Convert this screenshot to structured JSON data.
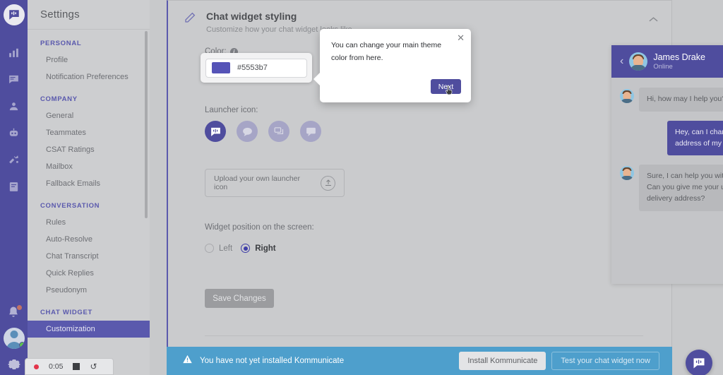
{
  "rail": {
    "logo_icon": "kommunicate-logo-icon",
    "icons": [
      "analytics-icon",
      "conversations-icon",
      "contacts-icon",
      "bot-icon",
      "integrations-icon",
      "knowledge-base-icon"
    ],
    "bell_icon": "notification-bell-icon",
    "avatar_icon": "user-avatar",
    "gear_icon": "gear-icon"
  },
  "sidebar": {
    "title": "Settings",
    "groups": [
      {
        "label": "PERSONAL",
        "items": [
          {
            "label": "Profile",
            "active": false
          },
          {
            "label": "Notification Preferences",
            "active": false
          }
        ]
      },
      {
        "label": "COMPANY",
        "items": [
          {
            "label": "General",
            "active": false
          },
          {
            "label": "Teammates",
            "active": false
          },
          {
            "label": "CSAT Ratings",
            "active": false
          },
          {
            "label": "Mailbox",
            "active": false
          },
          {
            "label": "Fallback Emails",
            "active": false
          }
        ]
      },
      {
        "label": "CONVERSATION",
        "items": [
          {
            "label": "Rules",
            "active": false
          },
          {
            "label": "Auto-Resolve",
            "active": false
          },
          {
            "label": "Chat Transcript",
            "active": false
          },
          {
            "label": "Quick Replies",
            "active": false
          },
          {
            "label": "Pseudonym",
            "active": false
          }
        ]
      },
      {
        "label": "CHAT WIDGET",
        "items": [
          {
            "label": "Customization",
            "active": true
          }
        ]
      }
    ]
  },
  "card": {
    "title": "Chat widget styling",
    "subtitle": "Customize how your chat widget looks like",
    "pencil_icon": "pencil-icon",
    "collapse_icon": "chevron-up-icon",
    "color": {
      "label": "Color:",
      "info_icon": "info-icon",
      "value": "#5553b7",
      "swatch_hex": "#5553b7"
    },
    "launcher": {
      "label": "Launcher icon:",
      "options": [
        "launcher-icon-kommunicate",
        "launcher-icon-speech-bubble",
        "launcher-icon-stacked-chat",
        "launcher-icon-square-chat"
      ],
      "selected_index": 0,
      "upload_text": "Upload your own launcher icon",
      "upload_icon": "upload-icon"
    },
    "position": {
      "label": "Widget position on the screen:",
      "options": [
        {
          "label": "Left",
          "selected": false
        },
        {
          "label": "Right",
          "selected": true
        }
      ]
    },
    "save_label": "Save Changes"
  },
  "chat_preview": {
    "back_icon": "chevron-left-icon",
    "agent_name": "James Drake",
    "agent_status": "Online",
    "messages": [
      {
        "from": "agent",
        "text": "Hi, how may I help you?"
      },
      {
        "from": "user",
        "text": "Hey, can I change the delivery address of my order?"
      },
      {
        "from": "agent",
        "text": "Sure, I can help you with this. Can you give me your updated delivery address?"
      }
    ],
    "fab_icon": "launcher-icon-kommunicate"
  },
  "tour": {
    "text": "You can change your main theme color from here.",
    "next_label": "Next",
    "close_icon": "close-icon",
    "cursor_icon": "pointer-cursor-icon"
  },
  "banner": {
    "warning_icon": "warning-icon",
    "text": "You have not yet installed Kommunicate",
    "install_label": "Install Kommunicate",
    "test_label": "Test your chat widget now"
  },
  "recorder": {
    "time": "0:05",
    "record_dot": "record-dot-icon",
    "stop_icon": "stop-icon",
    "restart_icon": "restart-icon"
  },
  "colors": {
    "brand_purple": "#4f4d9e",
    "theme_hex": "#5553b7",
    "banner_blue": "#4e9fcc"
  }
}
